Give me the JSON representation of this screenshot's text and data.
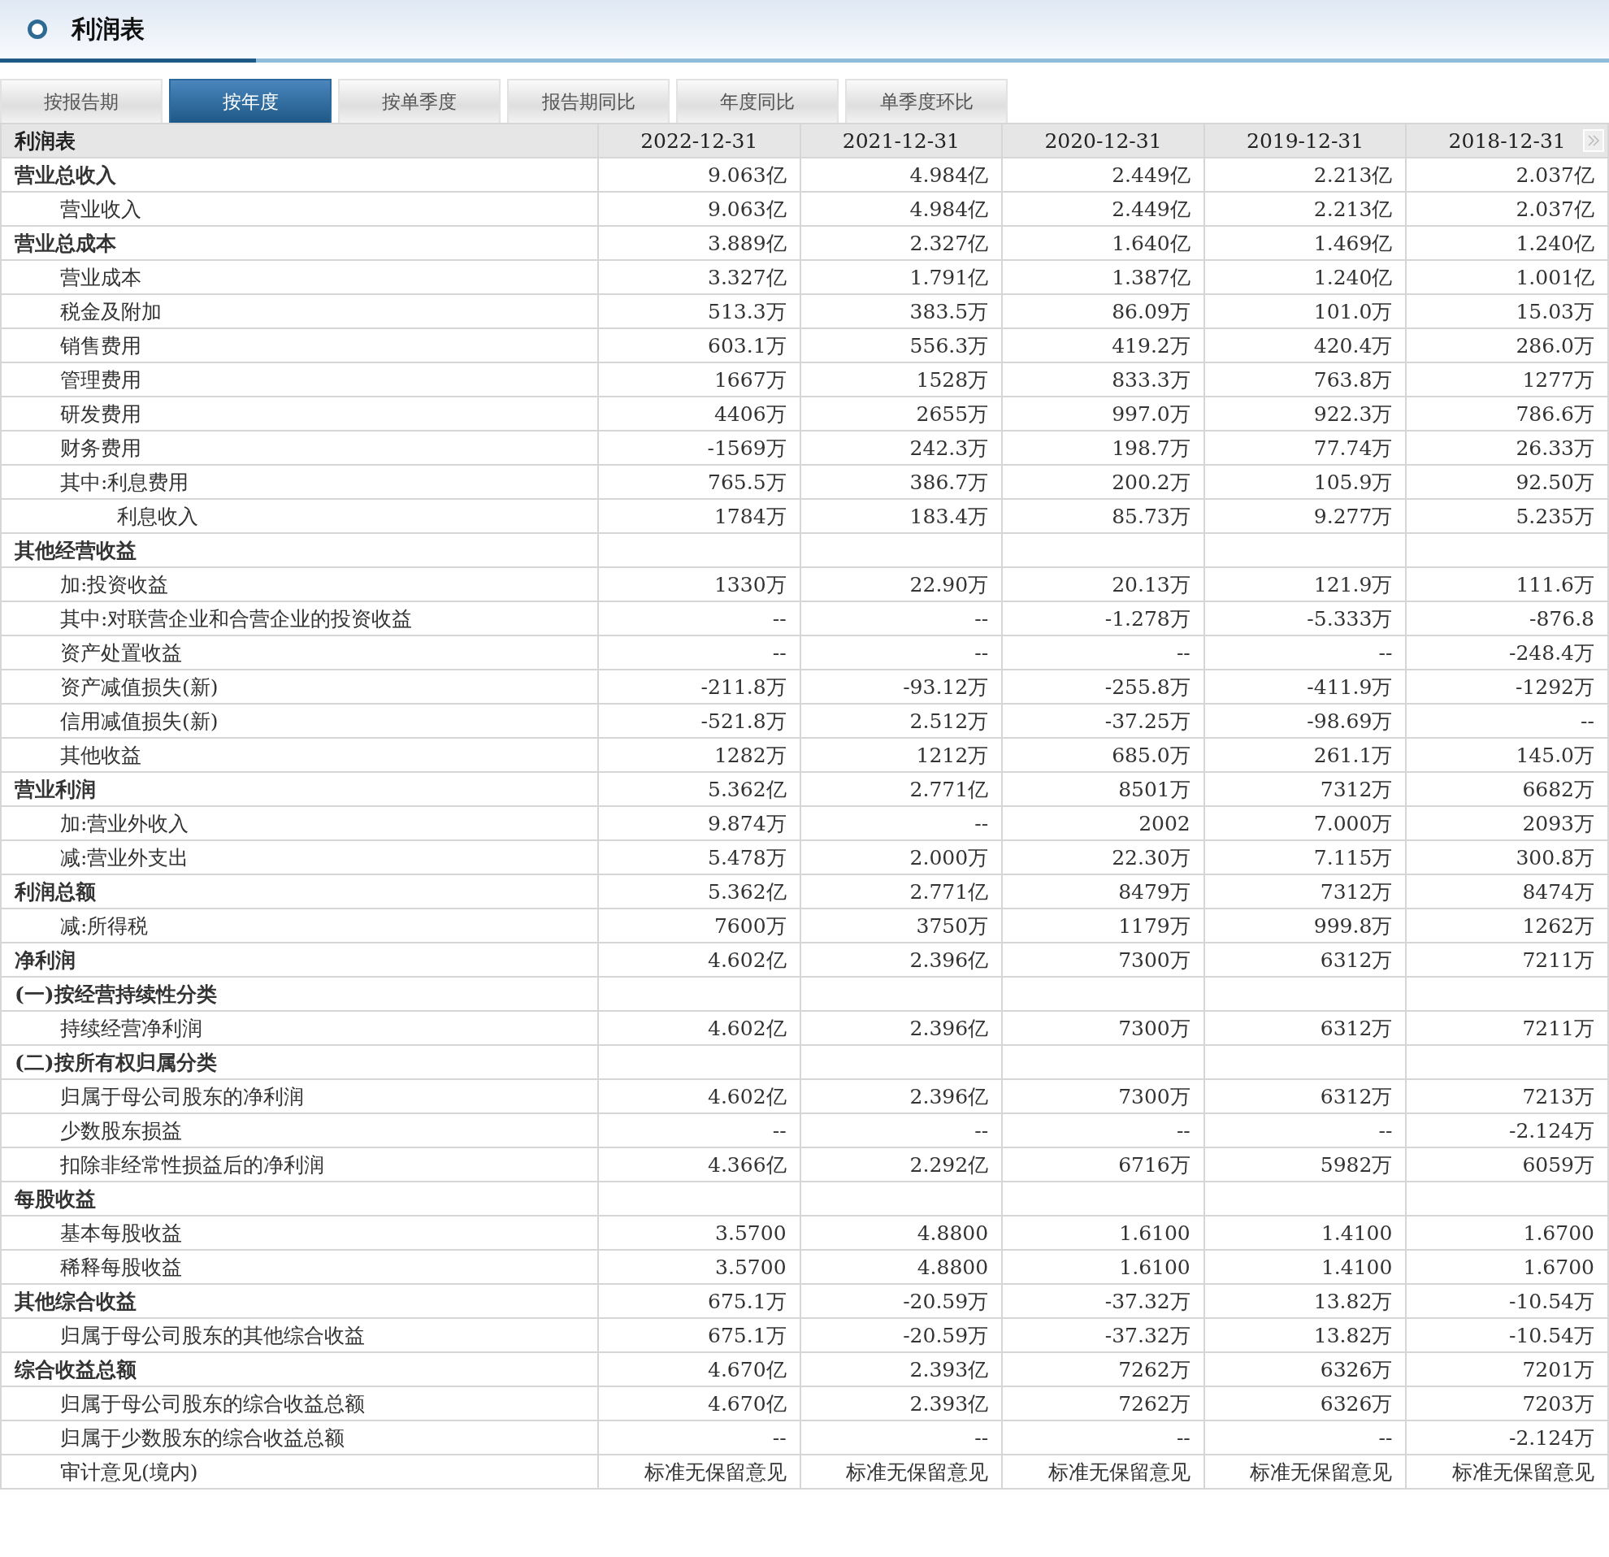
{
  "title": "利润表",
  "tabs": [
    {
      "label": "按报告期",
      "selected": false
    },
    {
      "label": "按年度",
      "selected": true
    },
    {
      "label": "按单季度",
      "selected": false
    },
    {
      "label": "报告期同比",
      "selected": false
    },
    {
      "label": "年度同比",
      "selected": false
    },
    {
      "label": "单季度环比",
      "selected": false
    }
  ],
  "table": {
    "columns": [
      "利润表",
      "2022-12-31",
      "2021-12-31",
      "2020-12-31",
      "2019-12-31",
      "2018-12-31"
    ],
    "rows": [
      {
        "kind": "heading",
        "label": "营业总收入",
        "values": [
          "9.063亿",
          "4.984亿",
          "2.449亿",
          "2.213亿",
          "2.037亿"
        ]
      },
      {
        "kind": "item",
        "label": "营业收入",
        "values": [
          "9.063亿",
          "4.984亿",
          "2.449亿",
          "2.213亿",
          "2.037亿"
        ]
      },
      {
        "kind": "heading",
        "label": "营业总成本",
        "values": [
          "3.889亿",
          "2.327亿",
          "1.640亿",
          "1.469亿",
          "1.240亿"
        ]
      },
      {
        "kind": "item",
        "label": "营业成本",
        "values": [
          "3.327亿",
          "1.791亿",
          "1.387亿",
          "1.240亿",
          "1.001亿"
        ]
      },
      {
        "kind": "item",
        "label": "税金及附加",
        "values": [
          "513.3万",
          "383.5万",
          "86.09万",
          "101.0万",
          "15.03万"
        ]
      },
      {
        "kind": "item",
        "label": "销售费用",
        "values": [
          "603.1万",
          "556.3万",
          "419.2万",
          "420.4万",
          "286.0万"
        ]
      },
      {
        "kind": "item",
        "label": "管理费用",
        "values": [
          "1667万",
          "1528万",
          "833.3万",
          "763.8万",
          "1277万"
        ]
      },
      {
        "kind": "item",
        "label": "研发费用",
        "values": [
          "4406万",
          "2655万",
          "997.0万",
          "922.3万",
          "786.6万"
        ]
      },
      {
        "kind": "item",
        "label": "财务费用",
        "values": [
          "-1569万",
          "242.3万",
          "198.7万",
          "77.74万",
          "26.33万"
        ]
      },
      {
        "kind": "item",
        "label": "其中:利息费用",
        "values": [
          "765.5万",
          "386.7万",
          "200.2万",
          "105.9万",
          "92.50万"
        ]
      },
      {
        "kind": "subitem",
        "label": "利息收入",
        "values": [
          "1784万",
          "183.4万",
          "85.73万",
          "9.277万",
          "5.235万"
        ]
      },
      {
        "kind": "heading",
        "label": "其他经营收益",
        "values": []
      },
      {
        "kind": "item",
        "label": "加:投资收益",
        "values": [
          "1330万",
          "22.90万",
          "20.13万",
          "121.9万",
          "111.6万"
        ]
      },
      {
        "kind": "item",
        "label": "其中:对联营企业和合营企业的投资收益",
        "values": [
          "--",
          "--",
          "-1.278万",
          "-5.333万",
          "-876.8"
        ]
      },
      {
        "kind": "item",
        "label": "资产处置收益",
        "values": [
          "--",
          "--",
          "--",
          "--",
          "-248.4万"
        ]
      },
      {
        "kind": "item",
        "label": "资产减值损失(新)",
        "values": [
          "-211.8万",
          "-93.12万",
          "-255.8万",
          "-411.9万",
          "-1292万"
        ]
      },
      {
        "kind": "item",
        "label": "信用减值损失(新)",
        "values": [
          "-521.8万",
          "2.512万",
          "-37.25万",
          "-98.69万",
          "--"
        ]
      },
      {
        "kind": "item",
        "label": "其他收益",
        "values": [
          "1282万",
          "1212万",
          "685.0万",
          "261.1万",
          "145.0万"
        ]
      },
      {
        "kind": "heading",
        "label": "营业利润",
        "values": [
          "5.362亿",
          "2.771亿",
          "8501万",
          "7312万",
          "6682万"
        ]
      },
      {
        "kind": "item",
        "label": "加:营业外收入",
        "values": [
          "9.874万",
          "--",
          "2002",
          "7.000万",
          "2093万"
        ]
      },
      {
        "kind": "item",
        "label": "减:营业外支出",
        "values": [
          "5.478万",
          "2.000万",
          "22.30万",
          "7.115万",
          "300.8万"
        ]
      },
      {
        "kind": "heading",
        "label": "利润总额",
        "values": [
          "5.362亿",
          "2.771亿",
          "8479万",
          "7312万",
          "8474万"
        ]
      },
      {
        "kind": "item",
        "label": "减:所得税",
        "values": [
          "7600万",
          "3750万",
          "1179万",
          "999.8万",
          "1262万"
        ]
      },
      {
        "kind": "heading",
        "label": "净利润",
        "values": [
          "4.602亿",
          "2.396亿",
          "7300万",
          "6312万",
          "7211万"
        ]
      },
      {
        "kind": "heading",
        "label": "(一)按经营持续性分类",
        "values": []
      },
      {
        "kind": "item",
        "label": "持续经营净利润",
        "values": [
          "4.602亿",
          "2.396亿",
          "7300万",
          "6312万",
          "7211万"
        ]
      },
      {
        "kind": "heading",
        "label": "(二)按所有权归属分类",
        "values": []
      },
      {
        "kind": "item",
        "label": "归属于母公司股东的净利润",
        "values": [
          "4.602亿",
          "2.396亿",
          "7300万",
          "6312万",
          "7213万"
        ]
      },
      {
        "kind": "item",
        "label": "少数股东损益",
        "values": [
          "--",
          "--",
          "--",
          "--",
          "-2.124万"
        ]
      },
      {
        "kind": "item",
        "label": "扣除非经常性损益后的净利润",
        "values": [
          "4.366亿",
          "2.292亿",
          "6716万",
          "5982万",
          "6059万"
        ]
      },
      {
        "kind": "heading",
        "label": "每股收益",
        "values": []
      },
      {
        "kind": "item",
        "label": "基本每股收益",
        "values": [
          "3.5700",
          "4.8800",
          "1.6100",
          "1.4100",
          "1.6700"
        ]
      },
      {
        "kind": "item",
        "label": "稀释每股收益",
        "values": [
          "3.5700",
          "4.8800",
          "1.6100",
          "1.4100",
          "1.6700"
        ]
      },
      {
        "kind": "heading",
        "label": "其他综合收益",
        "values": [
          "675.1万",
          "-20.59万",
          "-37.32万",
          "13.82万",
          "-10.54万"
        ]
      },
      {
        "kind": "item",
        "label": "归属于母公司股东的其他综合收益",
        "values": [
          "675.1万",
          "-20.59万",
          "-37.32万",
          "13.82万",
          "-10.54万"
        ]
      },
      {
        "kind": "heading",
        "label": "综合收益总额",
        "values": [
          "4.670亿",
          "2.393亿",
          "7262万",
          "6326万",
          "7201万"
        ]
      },
      {
        "kind": "item",
        "label": "归属于母公司股东的综合收益总额",
        "values": [
          "4.670亿",
          "2.393亿",
          "7262万",
          "6326万",
          "7203万"
        ]
      },
      {
        "kind": "item",
        "label": "归属于少数股东的综合收益总额",
        "values": [
          "--",
          "--",
          "--",
          "--",
          "-2.124万"
        ]
      },
      {
        "kind": "item",
        "label": "审计意见(境内)",
        "values": [
          "标准无保留意见",
          "标准无保留意见",
          "标准无保留意见",
          "标准无保留意见",
          "标准无保留意见"
        ]
      }
    ]
  }
}
